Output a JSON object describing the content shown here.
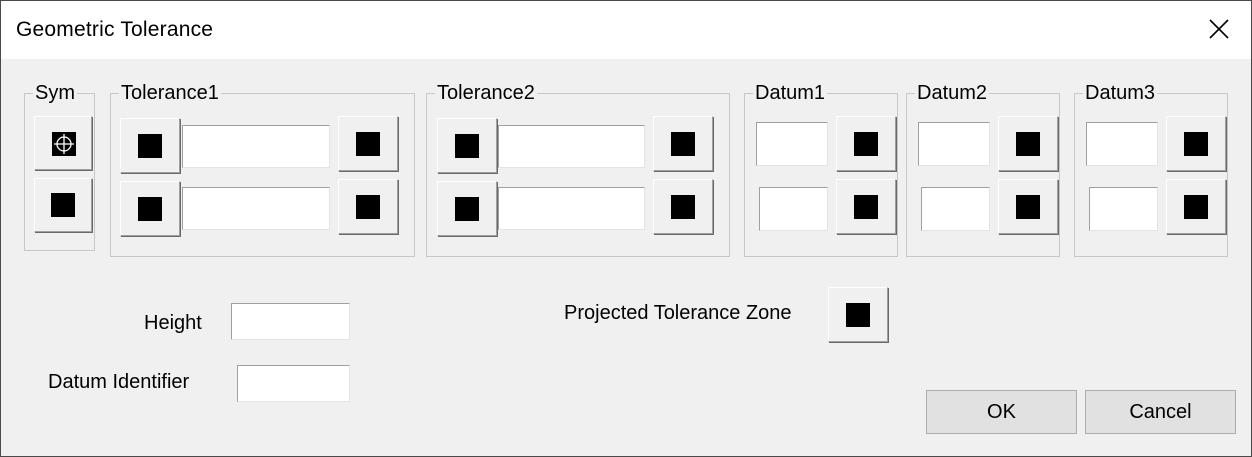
{
  "window": {
    "title": "Geometric Tolerance"
  },
  "groups": {
    "sym": "Sym",
    "tolerance1": "Tolerance1",
    "tolerance2": "Tolerance2",
    "datum1": "Datum1",
    "datum2": "Datum2",
    "datum3": "Datum3"
  },
  "fields": {
    "height_label": "Height",
    "datum_identifier_label": "Datum Identifier",
    "projected_label": "Projected Tolerance Zone"
  },
  "buttons": {
    "ok": "OK",
    "cancel": "Cancel"
  },
  "icons": {
    "close": "close-icon",
    "symbol": "position-crosshair-icon",
    "empty_symbol": "black-square-icon"
  }
}
